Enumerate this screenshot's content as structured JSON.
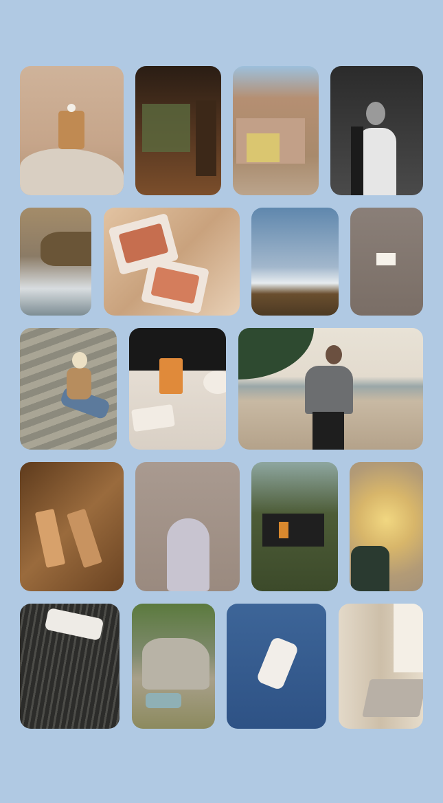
{
  "gallery": {
    "tiles": [
      {
        "id": "perfume-bottle-on-rock",
        "bg": "#c9a88a"
      },
      {
        "id": "dark-interior-room",
        "bg": "#3e2a1c"
      },
      {
        "id": "desert-house",
        "bg": "#b99a7c"
      },
      {
        "id": "man-portrait-bw",
        "bg": "#3a3a3a"
      },
      {
        "id": "ocean-waves-cliff",
        "bg": "#8f8473"
      },
      {
        "id": "blush-palette-on-silk",
        "bg": "#d5b598"
      },
      {
        "id": "sunset-sky-clouds",
        "bg": "#7f9cb8"
      },
      {
        "id": "grey-wall-light",
        "bg": "#877b74"
      },
      {
        "id": "woman-on-stairs",
        "bg": "#8f8c80"
      },
      {
        "id": "cocktail-table",
        "bg": "#d8cfc5"
      },
      {
        "id": "man-on-beach",
        "bg": "#c2b5a2"
      },
      {
        "id": "foundation-bottles-silk",
        "bg": "#7a5430"
      },
      {
        "id": "diffuser-vase",
        "bg": "#a08f84"
      },
      {
        "id": "treehouse-forest",
        "bg": "#4f5a3a"
      },
      {
        "id": "lamp-glow",
        "bg": "#b59d6e"
      },
      {
        "id": "comb-in-hair",
        "bg": "#3d3d3b"
      },
      {
        "id": "car-by-cliff",
        "bg": "#6e7a55"
      },
      {
        "id": "bottle-on-blue",
        "bg": "#35598a"
      },
      {
        "id": "jewelry-on-table",
        "bg": "#d6cab6"
      }
    ]
  }
}
